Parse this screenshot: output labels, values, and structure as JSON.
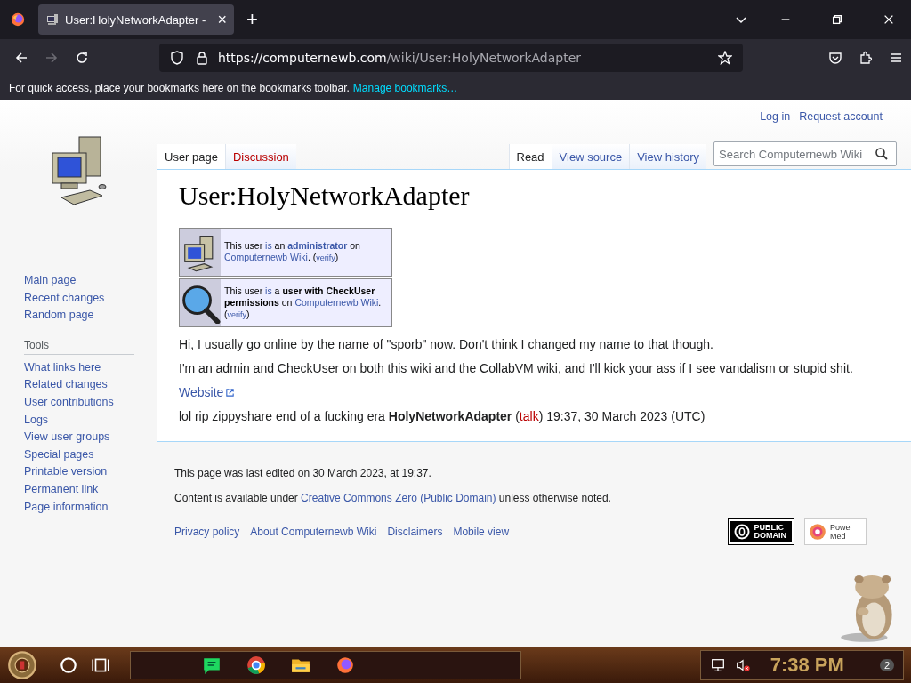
{
  "browser": {
    "tab": {
      "title": "User:HolyNetworkAdapter -",
      "selected": true
    },
    "close_tab": "×",
    "new_tab": "+",
    "url_host": "https://computernewb.com",
    "url_path": "/wiki/User:HolyNetworkAdapter",
    "bookmarks_hint": "For quick access, place your bookmarks here on the bookmarks toolbar.",
    "bookmarks_link": "Manage bookmarks…"
  },
  "personal": [
    "Log in",
    "Request account"
  ],
  "sidebar": {
    "nav": [
      "Main page",
      "Recent changes",
      "Random page"
    ],
    "tools_heading": "Tools",
    "tools": [
      "What links here",
      "Related changes",
      "User contributions",
      "Logs",
      "View user groups",
      "Special pages",
      "Printable version",
      "Permanent link",
      "Page information"
    ]
  },
  "tabs_left": [
    {
      "label": "User page",
      "selected": true,
      "missing": false
    },
    {
      "label": "Discussion",
      "selected": false,
      "missing": true
    }
  ],
  "tabs_right": [
    {
      "label": "Read",
      "selected": true
    },
    {
      "label": "View source",
      "selected": false
    },
    {
      "label": "View history",
      "selected": false
    }
  ],
  "search": {
    "placeholder": "Search Computernewb Wiki"
  },
  "title": "User:HolyNetworkAdapter",
  "userboxes": [
    {
      "kind": "computer",
      "segments": [
        {
          "kind": "plain",
          "text": "This user "
        },
        {
          "kind": "link",
          "text": "is"
        },
        {
          "kind": "plain",
          "text": " an "
        },
        {
          "kind": "boldlink",
          "text": "administrator"
        },
        {
          "kind": "plain",
          "text": " on "
        },
        {
          "kind": "link",
          "text": "Computernewb Wiki"
        },
        {
          "kind": "plain",
          "text": ". ("
        },
        {
          "kind": "small",
          "text": "verify"
        },
        {
          "kind": "plain",
          "text": ")"
        }
      ]
    },
    {
      "kind": "magnifier",
      "segments": [
        {
          "kind": "plain",
          "text": "This user "
        },
        {
          "kind": "link",
          "text": "is"
        },
        {
          "kind": "plain",
          "text": " a "
        },
        {
          "kind": "bold",
          "text": "user with CheckUser permissions"
        },
        {
          "kind": "plain",
          "text": " on "
        },
        {
          "kind": "link",
          "text": "Computernewb Wiki"
        },
        {
          "kind": "plain",
          "text": ". ("
        },
        {
          "kind": "small",
          "text": "verify"
        },
        {
          "kind": "plain",
          "text": ")"
        }
      ]
    }
  ],
  "paragraphs": [
    "Hi, I usually go online by the name of \"sporb\" now. Don't think I changed my name to that though.",
    "I'm an admin and CheckUser on both this wiki and the CollabVM wiki, and I'll kick your ass if I see vandalism or stupid shit."
  ],
  "website_link": "Website",
  "signature": [
    {
      "kind": "plain",
      "text": "lol rip zippyshare end of a fucking era "
    },
    {
      "kind": "bold",
      "text": "HolyNetworkAdapter"
    },
    {
      "kind": "plain",
      "text": " ("
    },
    {
      "kind": "redlink",
      "text": "talk"
    },
    {
      "kind": "plain",
      "text": ") 19:37, 30 March 2023 (UTC)"
    }
  ],
  "footer": {
    "last_edited": "This page was last edited on 30 March 2023, at 19:37.",
    "license": [
      {
        "kind": "plain",
        "text": "Content is available under "
      },
      {
        "kind": "link",
        "text": "Creative Commons Zero (Public Domain)"
      },
      {
        "kind": "plain",
        "text": " unless otherwise noted."
      }
    ],
    "links": [
      "Privacy policy",
      "About Computernewb Wiki",
      "Disclaimers",
      "Mobile view"
    ],
    "pd_badge": [
      "PUBLIC",
      "DOMAIN"
    ],
    "mw_badge": [
      "Powe",
      "Med"
    ]
  },
  "taskbar": {
    "time": "7:38 PM",
    "notifications": "2"
  }
}
